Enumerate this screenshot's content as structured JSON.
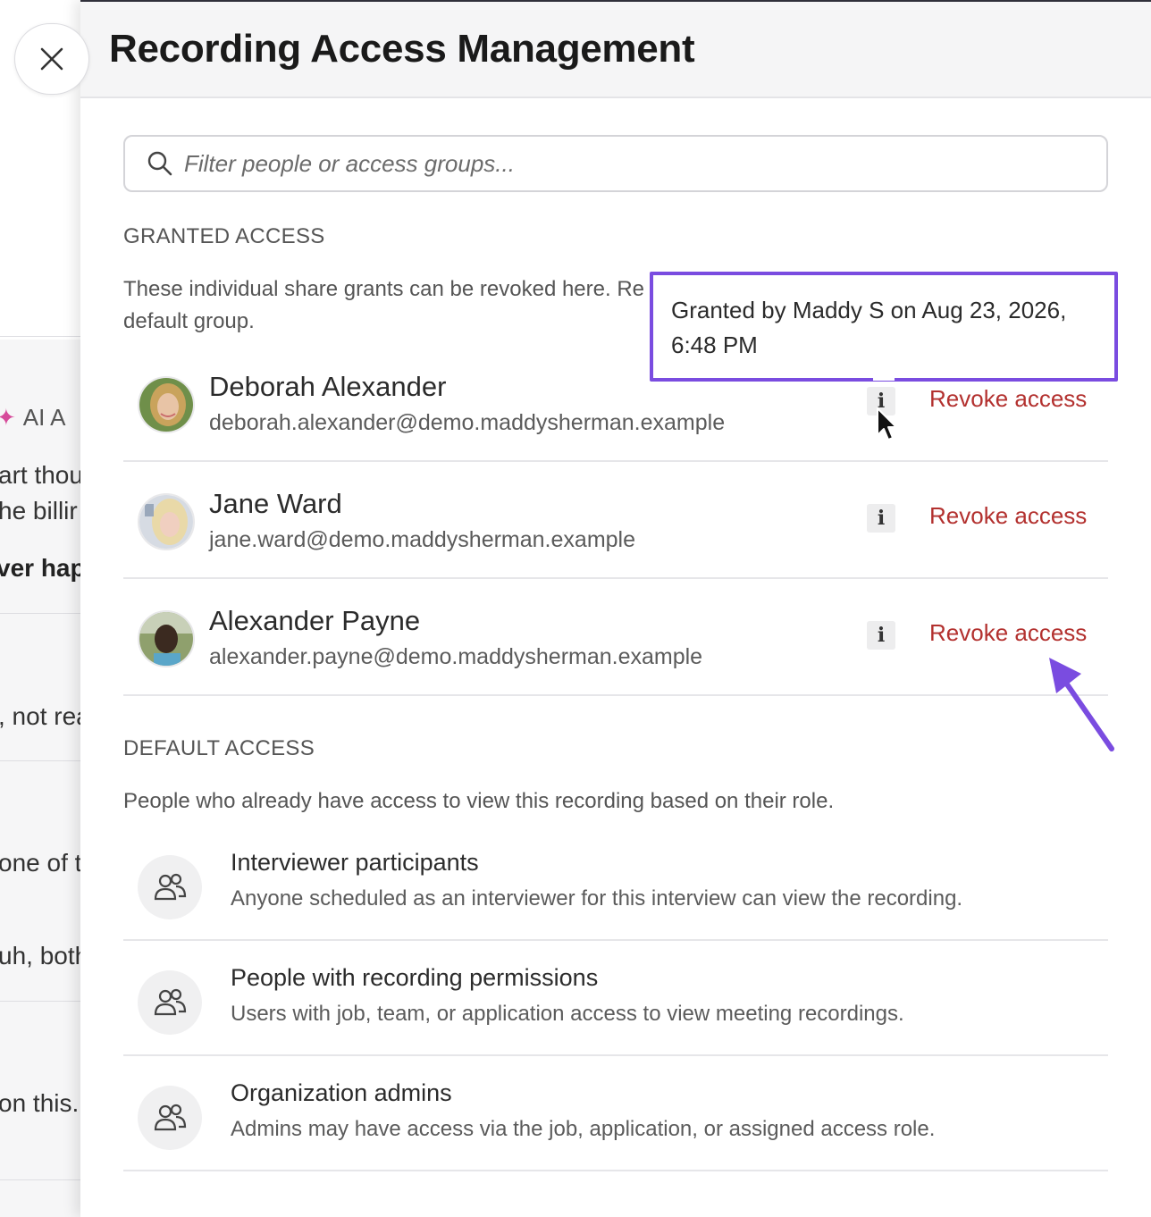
{
  "background": {
    "ai_label": "AI A",
    "fragments": [
      "art thou",
      "he billir",
      "ver hap",
      ", not rea",
      "one of tl",
      "uh, both",
      "on this. \\"
    ]
  },
  "close_button": {
    "icon": "close-icon"
  },
  "drawer": {
    "title": "Recording Access Management",
    "search": {
      "placeholder": "Filter people or access groups..."
    }
  },
  "granted": {
    "label": "GRANTED ACCESS",
    "description": "These individual share grants can be revoked here. Re",
    "description_line2": "default group.",
    "people": [
      {
        "name": "Deborah Alexander",
        "email": "deborah.alexander@demo.maddysherman.example",
        "info": "i",
        "action": "Revoke access"
      },
      {
        "name": "Jane Ward",
        "email": "jane.ward@demo.maddysherman.example",
        "info": "i",
        "action": "Revoke access"
      },
      {
        "name": "Alexander Payne",
        "email": "alexander.payne@demo.maddysherman.example",
        "info": "i",
        "action": "Revoke access"
      }
    ]
  },
  "tooltip": {
    "text": "Granted by Maddy S on Aug 23, 2026, 6:48 PM"
  },
  "default": {
    "label": "DEFAULT ACCESS",
    "description": "People who already have access to view this recording based on their role.",
    "groups": [
      {
        "title": "Interviewer participants",
        "description": "Anyone scheduled as an interviewer for this interview can view the recording."
      },
      {
        "title": "People with recording permissions",
        "description": "Users with job, team, or application access to view meeting recordings."
      },
      {
        "title": "Organization admins",
        "description": "Admins may have access via the job, application, or assigned access role."
      }
    ]
  },
  "colors": {
    "accent": "#7a4ce0",
    "revoke": "#b3312f"
  }
}
